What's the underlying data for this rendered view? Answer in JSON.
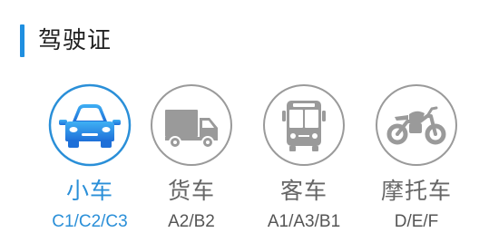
{
  "header": {
    "title": "驾驶证",
    "accent_color": "#1f8fe0"
  },
  "colors": {
    "selected": "#2a8fd8",
    "unselected_icon": "#9a9a9a",
    "unselected_text": "#666666"
  },
  "vehicles": [
    {
      "type": "小车",
      "classes": "C1/C2/C3",
      "icon": "car-icon",
      "selected": true
    },
    {
      "type": "货车",
      "classes": "A2/B2",
      "icon": "truck-icon",
      "selected": false
    },
    {
      "type": "客车",
      "classes": "A1/A3/B1",
      "icon": "bus-icon",
      "selected": false
    },
    {
      "type": "摩托车",
      "classes": "D/E/F",
      "icon": "motorcycle-icon",
      "selected": false
    }
  ]
}
